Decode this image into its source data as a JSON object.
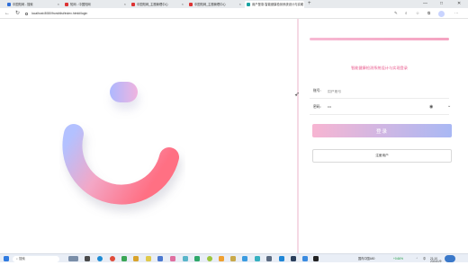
{
  "browser": {
    "tabs": [
      {
        "label": "中国知网 - 搜索",
        "fav_color": "#2f6fd8"
      },
      {
        "label": "知网 - 中国知网",
        "fav_color": "#d33"
      },
      {
        "label": "中国知网_主题管理中心",
        "fav_color": "#d33"
      },
      {
        "label": "中国知网_主题管理中心",
        "fav_color": "#d33"
      },
      {
        "label": "用户登录-智能健康检测系统设计与实现",
        "fav_color": "#1aa3a3",
        "active": true
      }
    ],
    "new_tab_glyph": "+",
    "url": "localhost:8080/front/dist/index.html#/login",
    "window_controls": [
      "—",
      "□",
      "✕"
    ]
  },
  "login": {
    "title": "智能健康检测系统设计与实现登录",
    "account_label": "账号:",
    "account_placeholder": "用户账号",
    "password_label": "密码:",
    "password_value": "•••",
    "login_button": "登录",
    "register_button": "注册用户"
  },
  "taskbar": {
    "search_label": "搜索",
    "weather": "国内中国A50",
    "weather_change": "+0.66%",
    "tray_lang": "中",
    "time": "21:10",
    "date": "2024/1/9"
  },
  "colors": {
    "accent_pink": "#f7b5d2",
    "accent_blue": "#a9b8f4",
    "title_pink": "#e8558a"
  }
}
